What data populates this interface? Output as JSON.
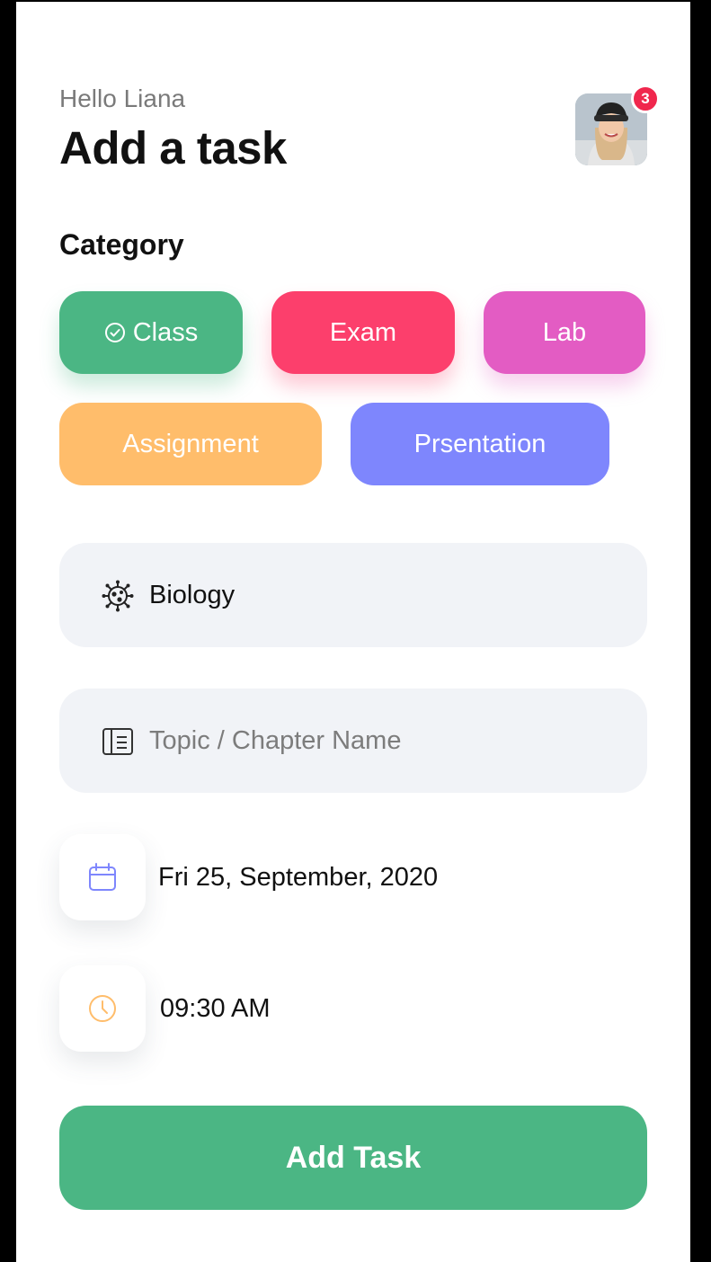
{
  "header": {
    "greeting": "Hello Liana",
    "title": "Add a task",
    "notification_count": "3"
  },
  "category": {
    "label": "Category",
    "chips": [
      {
        "label": "Class",
        "color": "#4bb684",
        "selected": true,
        "icon": "check-circle-icon"
      },
      {
        "label": "Exam",
        "color": "#fc3f6c",
        "selected": false
      },
      {
        "label": "Lab",
        "color": "#e35cc3",
        "selected": false
      },
      {
        "label": "Assignment",
        "color": "#ffbd6b",
        "selected": false
      },
      {
        "label": "Prsentation",
        "color": "#7e86fd",
        "selected": false
      }
    ]
  },
  "form": {
    "subject": {
      "value": "Biology",
      "icon": "virus-icon"
    },
    "topic": {
      "value": "",
      "placeholder": "Topic / Chapter Name",
      "icon": "notes-icon"
    },
    "date": {
      "value": "Fri 25, September, 2020",
      "icon": "calendar-icon",
      "icon_color": "#7e86fd"
    },
    "time": {
      "value": "09:30 AM",
      "icon": "clock-icon",
      "icon_color": "#ffbd6b"
    }
  },
  "actions": {
    "submit_label": "Add Task",
    "submit_color": "#4bb684"
  }
}
